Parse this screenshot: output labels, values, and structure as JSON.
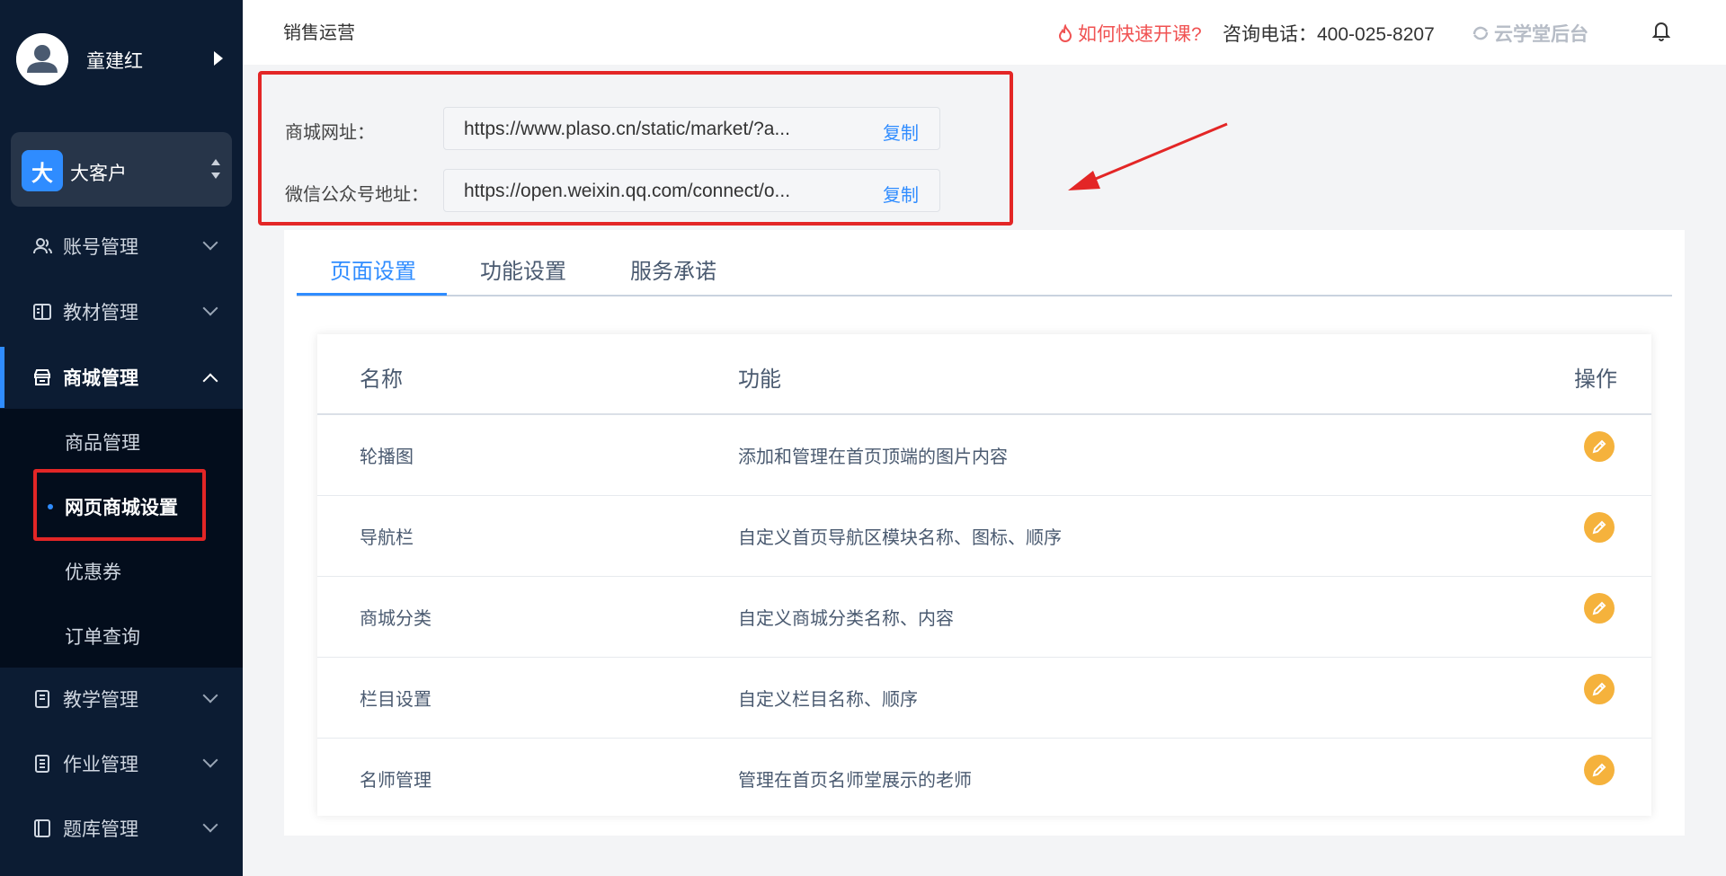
{
  "sidebar": {
    "user_name": "童建红",
    "org": {
      "badge": "大",
      "name": "大客户"
    },
    "menu": [
      {
        "key": "account",
        "label": "账号管理",
        "icon": "user-icon"
      },
      {
        "key": "textbook",
        "label": "教材管理",
        "icon": "book-icon"
      },
      {
        "key": "mall",
        "label": "商城管理",
        "icon": "shop-icon"
      },
      {
        "key": "teaching",
        "label": "教学管理",
        "icon": "notebook-icon"
      },
      {
        "key": "homework",
        "label": "作业管理",
        "icon": "list-icon"
      },
      {
        "key": "question-bank",
        "label": "题库管理",
        "icon": "copy-icon"
      }
    ],
    "submenu": [
      {
        "label": "商品管理"
      },
      {
        "label": "网页商城设置",
        "active": true
      },
      {
        "label": "优惠券"
      },
      {
        "label": "订单查询"
      }
    ]
  },
  "header": {
    "breadcrumb": "销售运营",
    "hot_link": "如何快速开课?",
    "phone": "咨询电话：400-025-8207",
    "brand": "云学堂后台"
  },
  "urls": [
    {
      "label": "商城网址：",
      "value": "https://www.plaso.cn/static/market/?a...",
      "copy": "复制"
    },
    {
      "label": "微信公众号地址：",
      "value": "https://open.weixin.qq.com/connect/o...",
      "copy": "复制"
    }
  ],
  "tabs": [
    {
      "label": "页面设置",
      "active": true
    },
    {
      "label": "功能设置"
    },
    {
      "label": "服务承诺"
    }
  ],
  "table": {
    "headers": {
      "name": "名称",
      "func": "功能",
      "op": "操作"
    },
    "rows": [
      {
        "name": "轮播图",
        "func": "添加和管理在首页顶端的图片内容"
      },
      {
        "name": "导航栏",
        "func": "自定义首页导航区模块名称、图标、顺序"
      },
      {
        "name": "商城分类",
        "func": "自定义商城分类名称、内容"
      },
      {
        "name": "栏目设置",
        "func": "自定义栏目名称、顺序"
      },
      {
        "name": "名师管理",
        "func": "管理在首页名师堂展示的老师"
      }
    ]
  },
  "colors": {
    "sidebar_bg": "#0c1c33",
    "accent": "#2f8cff",
    "highlight_red": "#e32626",
    "edit_orange": "#f5b23c"
  }
}
